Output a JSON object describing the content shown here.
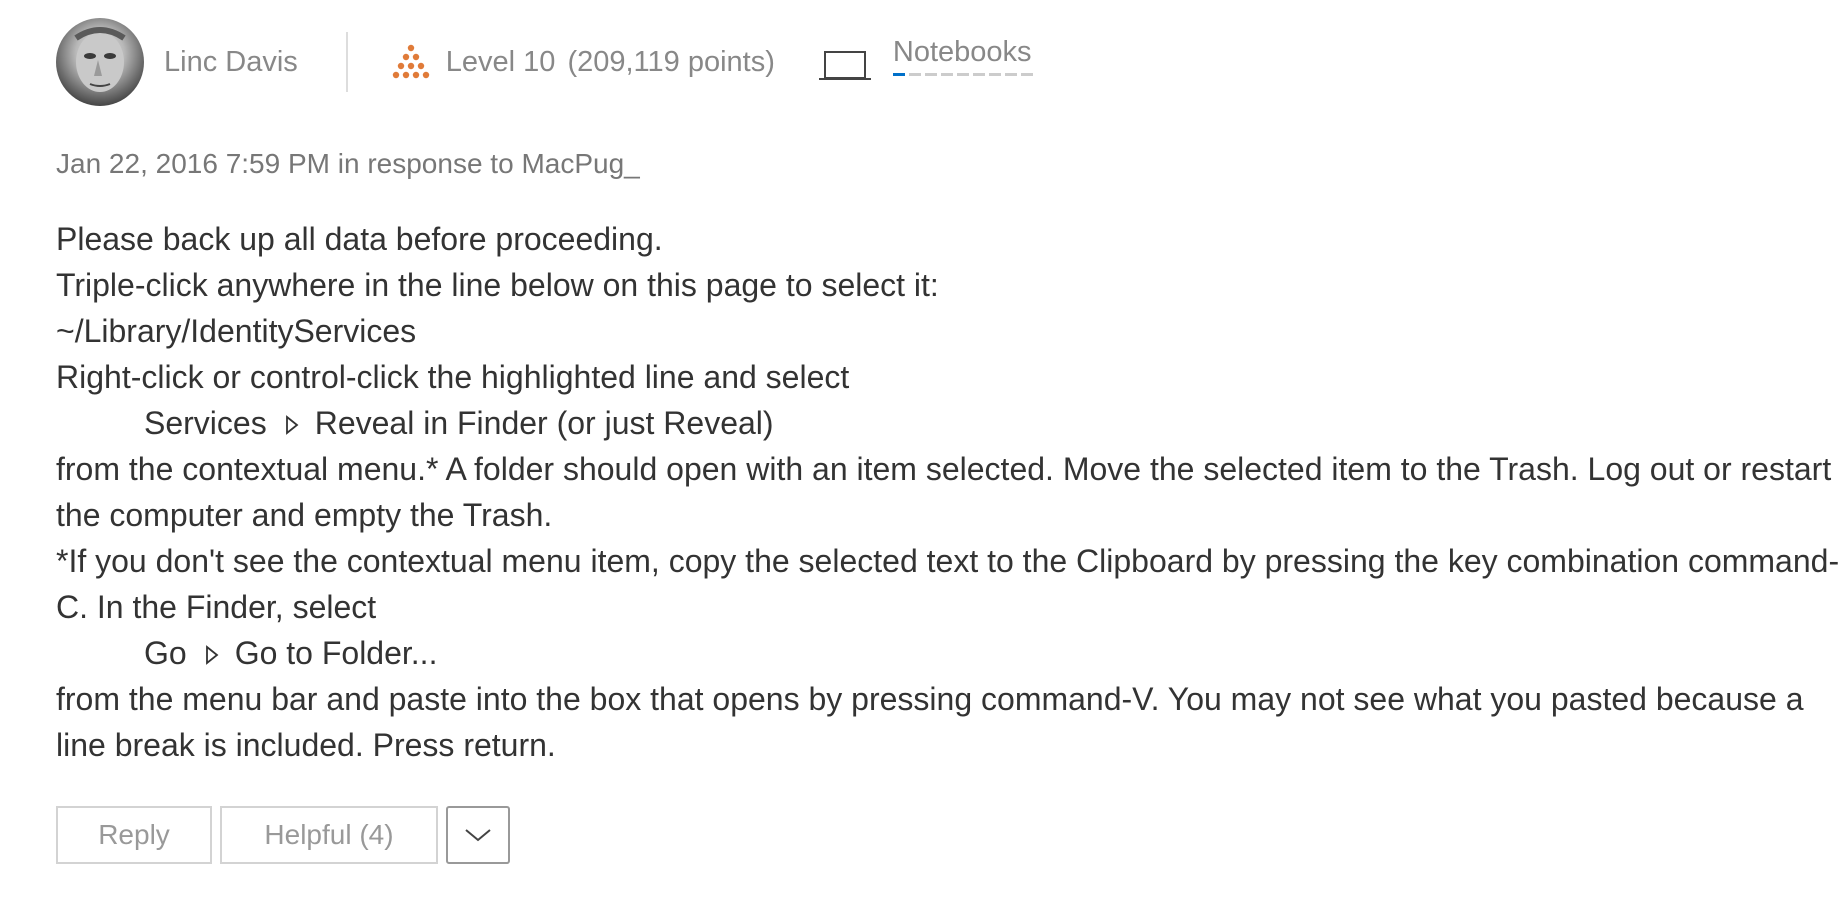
{
  "author": {
    "name": "Linc Davis",
    "level": "Level 10",
    "points": "(209,119 points)",
    "notebooks_label": "Notebooks",
    "notebooks_progress": 0.1
  },
  "meta": {
    "timestamp": "Jan 22, 2016 7:59 PM",
    "in_response_to": "in response to",
    "responder": "MacPug_"
  },
  "body": {
    "line1": "Please back up all data before proceeding.",
    "line2": "Triple-click anywhere in the line below on this page to select it:",
    "path": "~/Library/IdentityServices",
    "line4": "Right-click or control-click the highlighted line and select",
    "menu1_part1": "Services",
    "menu1_part2": "Reveal in Finder (or just Reveal)",
    "line6": "from the contextual menu.* A folder should open with an item selected. Move the selected item to the Trash. Log out or restart the computer and empty the Trash.",
    "line7": "*If you don't see the contextual menu item, copy the selected text to the Clipboard by pressing the key combination command-C. In the Finder, select",
    "menu2_part1": "Go",
    "menu2_part2": "Go to Folder...",
    "line9": "from the menu bar and paste into the box that opens by pressing command-V. You may not see what you pasted because a line break is included. Press return."
  },
  "actions": {
    "reply_label": "Reply",
    "helpful_label": "Helpful (4)",
    "more_icon": "chevron-down-icon"
  },
  "colors": {
    "text": "#333333",
    "muted": "#888888",
    "level_icon": "#e07b39",
    "notebooks_accent": "#0070c9",
    "button_border": "#d3d3d3"
  }
}
